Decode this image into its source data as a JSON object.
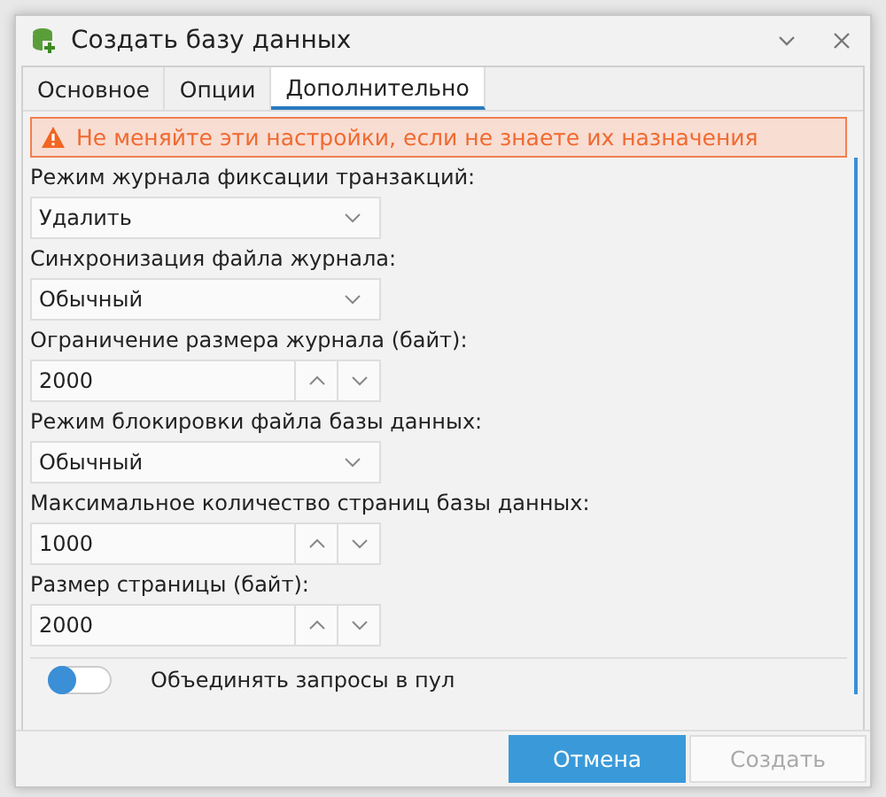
{
  "window": {
    "title": "Создать базу данных"
  },
  "tabs": [
    {
      "label": "Основное",
      "selected": false
    },
    {
      "label": "Опции",
      "selected": false
    },
    {
      "label": "Дополнительно",
      "selected": true
    }
  ],
  "warning": "Не меняйте эти настройки, если не знаете их назначения",
  "fields": [
    {
      "kind": "select",
      "label": "Режим журнала фиксации транзакций:",
      "value": "Удалить"
    },
    {
      "kind": "select",
      "label": "Синхронизация файла журнала:",
      "value": "Обычный"
    },
    {
      "kind": "spinner",
      "label": "Ограничение размера журнала (байт):",
      "value": "2000"
    },
    {
      "kind": "select",
      "label": "Режим блокировки файла базы данных:",
      "value": "Обычный"
    },
    {
      "kind": "spinner",
      "label": "Максимальное количество страниц базы данных:",
      "value": "1000"
    },
    {
      "kind": "spinner",
      "label": "Размер страницы (байт):",
      "value": "2000"
    }
  ],
  "toggle": {
    "label": "Объединять запросы в пул",
    "on": false
  },
  "buttons": [
    {
      "label": "Отмена",
      "kind": "primary",
      "disabled": false
    },
    {
      "label": "Создать",
      "kind": "secondary",
      "disabled": true
    }
  ]
}
